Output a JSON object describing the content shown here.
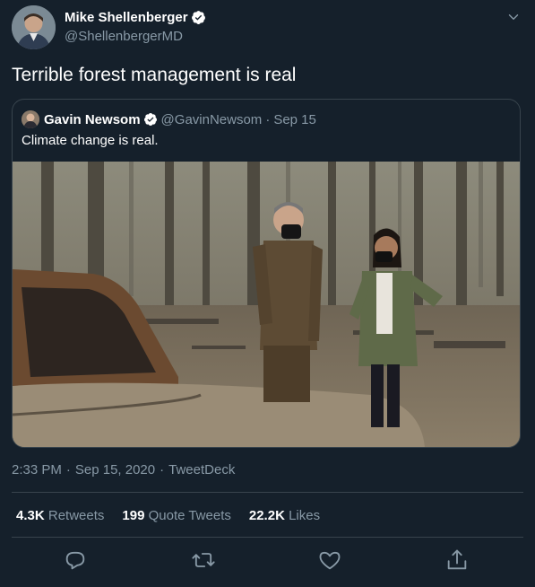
{
  "author": {
    "name": "Mike Shellenberger",
    "handle": "@ShellenbergerMD"
  },
  "tweet_text": "Terrible forest management is real",
  "quoted": {
    "name": "Gavin Newsom",
    "handle": "@GavinNewsom",
    "separator": "·",
    "date": "Sep 15",
    "text": "Climate change is real."
  },
  "meta": {
    "time": "2:33 PM",
    "sep1": "·",
    "date": "Sep 15, 2020",
    "sep2": "·",
    "source": "TweetDeck"
  },
  "stats": {
    "retweets_count": "4.3K",
    "retweets_label": "Retweets",
    "quotes_count": "199",
    "quotes_label": "Quote Tweets",
    "likes_count": "22.2K",
    "likes_label": "Likes"
  },
  "icons": {
    "verified": "verified-badge-icon",
    "caret": "chevron-down-icon",
    "reply": "reply-icon",
    "retweet": "retweet-icon",
    "like": "heart-icon",
    "share": "share-icon"
  },
  "colors": {
    "background": "#15202b",
    "secondary_text": "#8899a6",
    "border": "#38444d",
    "verified": "#ffffff"
  }
}
